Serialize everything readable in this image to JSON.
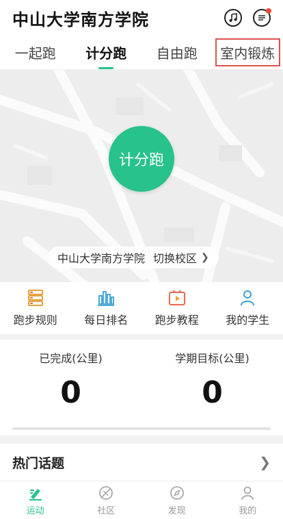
{
  "header": {
    "title": "中山大学南方学院",
    "icons": [
      "music-icon",
      "message-icon"
    ]
  },
  "tabs": [
    {
      "label": "一起跑",
      "active": false
    },
    {
      "label": "计分跑",
      "active": true
    },
    {
      "label": "自由跑",
      "active": false
    },
    {
      "label": "室内锻炼",
      "active": false
    }
  ],
  "annotation": "1",
  "map": {
    "start_button": "计分跑",
    "campus_name": "中山大学南方学院",
    "switch_campus": "切换校区"
  },
  "quick_actions": [
    {
      "label": "跑步规则",
      "icon": "rules-icon",
      "color": "#e8a23a"
    },
    {
      "label": "每日排名",
      "icon": "ranking-icon",
      "color": "#3aa0d8"
    },
    {
      "label": "跑步教程",
      "icon": "tutorial-icon",
      "color": "#e86a4a"
    },
    {
      "label": "我的学生",
      "icon": "student-icon",
      "color": "#3aa0d8"
    }
  ],
  "stats": {
    "completed_label": "已完成(公里)",
    "completed_value": "0",
    "target_label": "学期目标(公里)",
    "target_value": "0",
    "progress": 0
  },
  "hot_topics": {
    "title": "热门话题"
  },
  "bottom_nav": [
    {
      "label": "运动",
      "icon": "sport-icon",
      "active": true
    },
    {
      "label": "社区",
      "icon": "community-icon",
      "active": false
    },
    {
      "label": "发现",
      "icon": "discover-icon",
      "active": false
    },
    {
      "label": "我的",
      "icon": "profile-icon",
      "active": false
    }
  ],
  "colors": {
    "accent": "#27c38a",
    "annotation": "#d63a2a"
  }
}
